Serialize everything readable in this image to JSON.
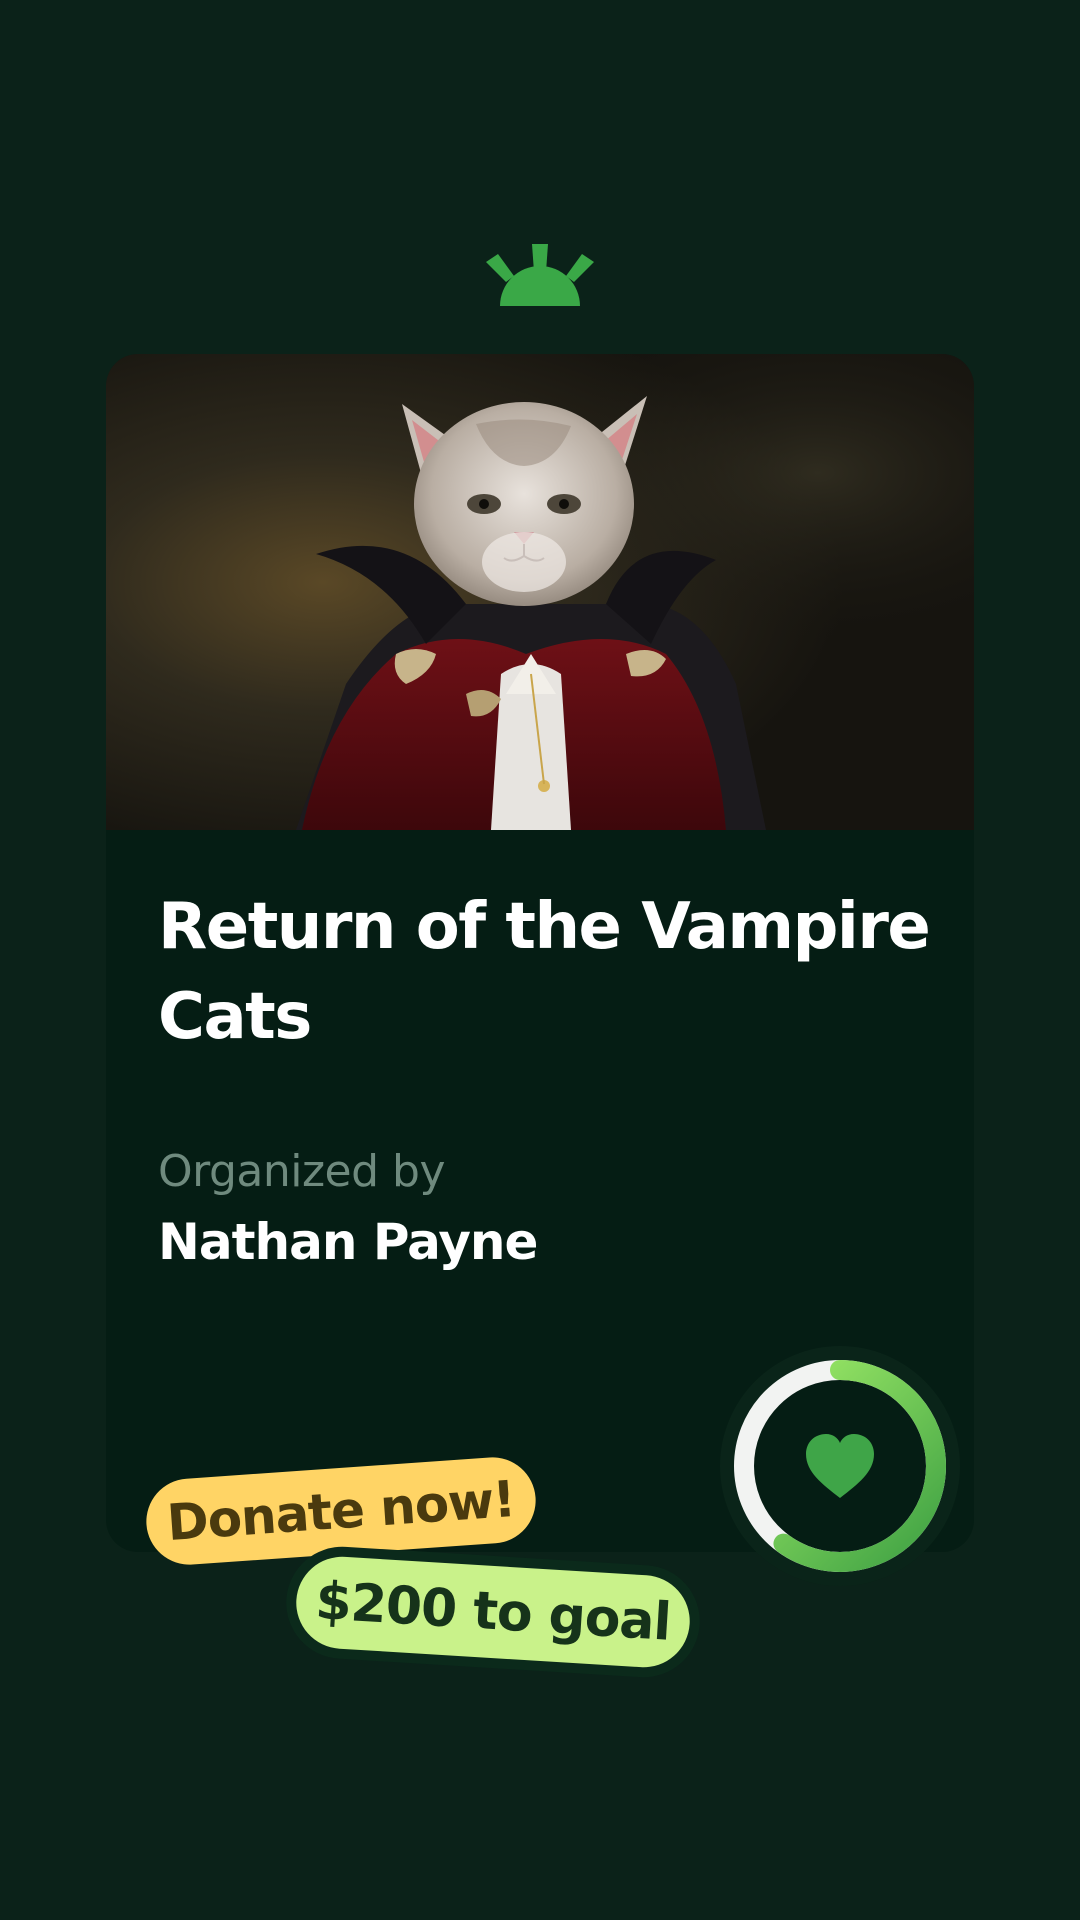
{
  "campaign": {
    "title": "Return of the Vampire Cats",
    "organized_label": "Organized by",
    "organizer_name": "Nathan Payne"
  },
  "tags": {
    "donate_label": "Donate now!",
    "goal_label": "$200 to goal"
  },
  "progress": {
    "fraction": 0.6
  },
  "icons": {
    "logo": "sunrise-logo-icon",
    "progress_center": "heart-icon"
  },
  "colors": {
    "background": "#0b2219",
    "card": "#051d14",
    "brand_green": "#3aa847",
    "ring_start": "#3da043",
    "ring_end": "#a6f06a",
    "donate_tag": "#ffd465",
    "goal_tag": "#c9f28a",
    "muted_text": "#6f8a7e"
  }
}
